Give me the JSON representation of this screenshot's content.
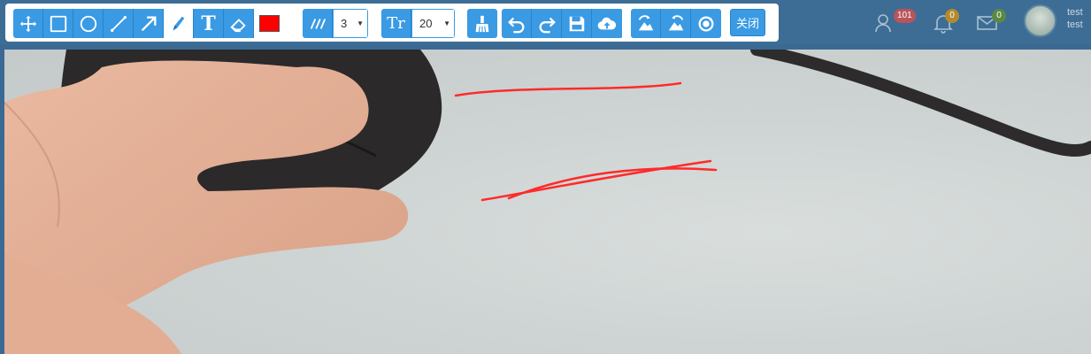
{
  "toolbar": {
    "tools": [
      {
        "name": "move-icon"
      },
      {
        "name": "rectangle-icon"
      },
      {
        "name": "circle-icon"
      },
      {
        "name": "line-icon"
      },
      {
        "name": "arrow-icon"
      },
      {
        "name": "pen-icon",
        "active": true
      },
      {
        "name": "text-icon",
        "label": "T"
      },
      {
        "name": "eraser-icon"
      }
    ],
    "pen_color": "#ff0000",
    "line_width": "3",
    "font_size": "20",
    "font_label": "Tr",
    "close_label": "关闭"
  },
  "header": {
    "users_count": "101",
    "notifications_count": "0",
    "messages_count": "0",
    "username_line1": "test",
    "username_line2": "test"
  },
  "colors": {
    "accent": "#3a9ae3",
    "header_bg": "#3d6d94",
    "stroke": "#ff2a2a"
  }
}
